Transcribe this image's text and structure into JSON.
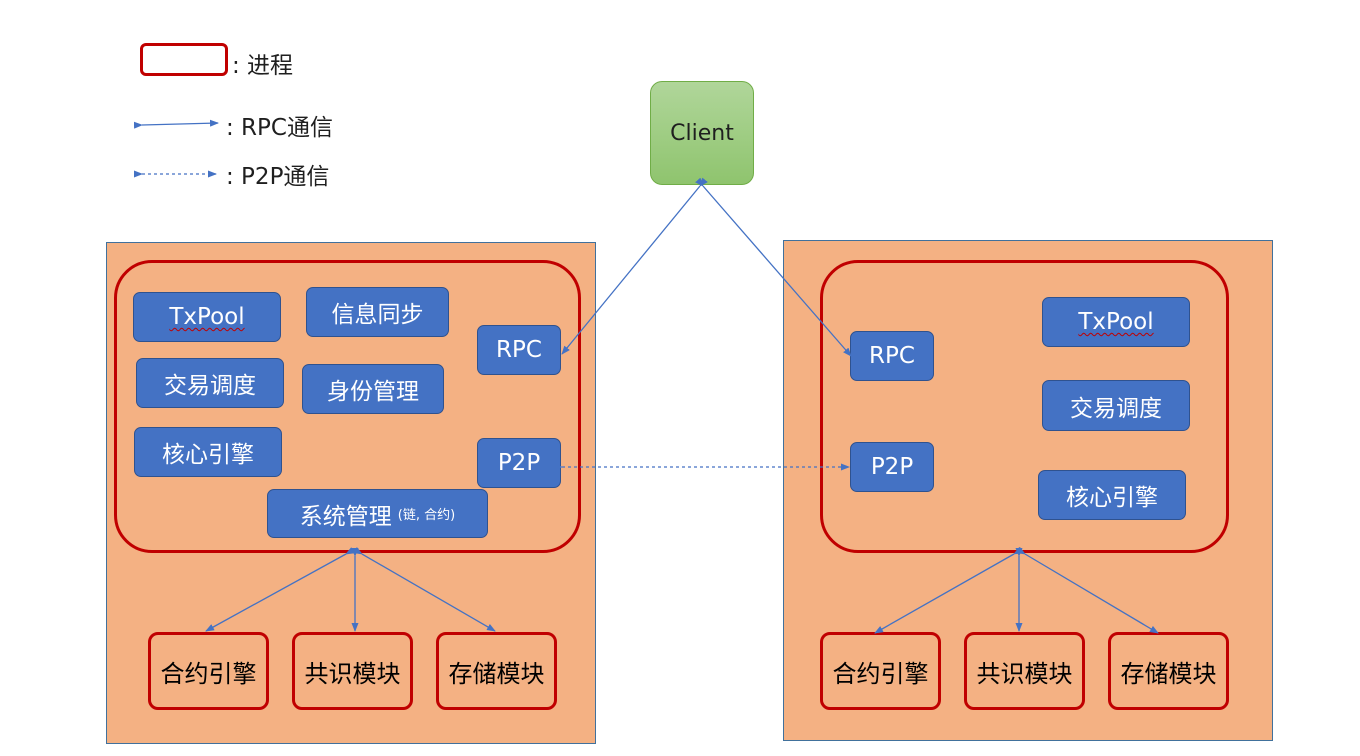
{
  "legend": {
    "process_label": ": 进程",
    "rpc_label": ": RPC通信",
    "p2p_label": ": P2P通信"
  },
  "client": {
    "label": "Client"
  },
  "left_node": {
    "components": {
      "txpool": "TxPool",
      "sync": "信息同步",
      "rpc": "RPC",
      "scheduler": "交易调度",
      "identity": "身份管理",
      "core": "核心引擎",
      "p2p": "P2P",
      "sysmgmt": "系统管理",
      "sysmgmt_note": "(链, 合约)"
    },
    "modules": {
      "contract": "合约引擎",
      "consensus": "共识模块",
      "storage": "存储模块"
    }
  },
  "right_node": {
    "components": {
      "rpc": "RPC",
      "txpool": "TxPool",
      "scheduler": "交易调度",
      "p2p": "P2P",
      "core": "核心引擎"
    },
    "modules": {
      "contract": "合约引擎",
      "consensus": "共识模块",
      "storage": "存储模块"
    }
  },
  "colors": {
    "process_border": "#c00000",
    "component_fill": "#4472c4",
    "node_fill": "#f4b183",
    "client_fill": "#a9d18e",
    "connector": "#4472c4"
  }
}
